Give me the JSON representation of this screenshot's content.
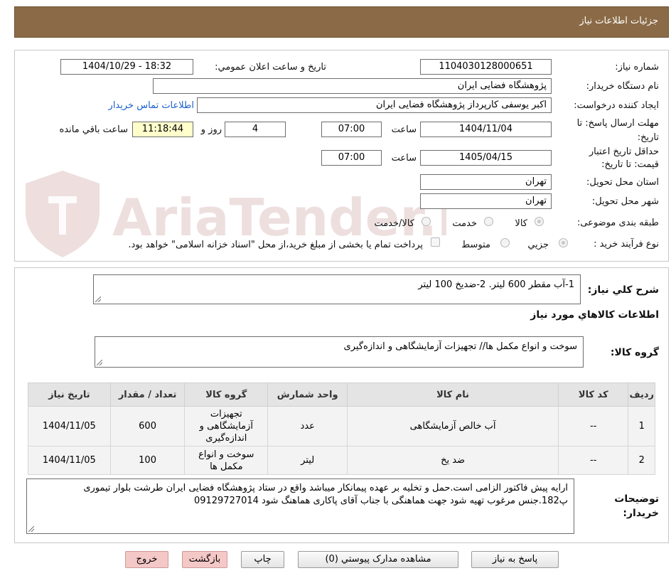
{
  "header": {
    "title": "جزئیات اطلاعات نیاز"
  },
  "form": {
    "need_number_label": "شماره نیاز:",
    "need_number": "1104030128000651",
    "announce_label": "تاریخ و ساعت اعلان عمومي:",
    "announce_value": "1404/10/29 - 18:32",
    "buyer_org_label": "نام دستگاه خریدار:",
    "buyer_org": "پژوهشگاه فضایی ایران",
    "requester_label": "ایجاد کننده درخواست:",
    "requester": "اکبر یوسفی کارپرداز پژوهشگاه فضایی ایران",
    "contact_link": "اطلاعات تماس خریدار",
    "deadline_label": "مهلت ارسال پاسخ: تا تاریخ:",
    "deadline_date": "1404/11/04",
    "time_label": "ساعت",
    "deadline_time": "07:00",
    "days_value": "4",
    "days_label": "روز و",
    "remaining_time": "11:18:44",
    "remaining_label": "ساعت باقي مانده",
    "validity_label": "حداقل تاریخ اعتبار قیمت: تا تاریخ:",
    "validity_date": "1405/04/15",
    "validity_time": "07:00",
    "province_label": "استان محل تحویل:",
    "province": "تهران",
    "city_label": "شهر محل تحویل:",
    "city": "تهران",
    "category_label": "طبقه بندی موضوعی:",
    "category_options": [
      "کالا",
      "خدمت",
      "کالا/خدمت"
    ],
    "process_label": "نوع فرآیند خرید :",
    "process_options": [
      "جزیي",
      "متوسط"
    ],
    "payment_note": "پرداخت تمام یا بخشی از مبلغ خرید،از محل \"اسناد خزانه اسلامی\" خواهد بود."
  },
  "summary": {
    "label": "شرح کلي نیاز:",
    "text": "1-آب مقطر 600 لیتر. 2-ضدیخ  100 لیتر"
  },
  "goods": {
    "section_title": "اطلاعات کالاهاي مورد نیاز",
    "group_label": "گروه کالا:",
    "group_text": "سوخت و انواع مکمل ها// تجهیزات آزمایشگاهی و اندازه‌گیری"
  },
  "table": {
    "headers": [
      "ردیف",
      "کد کالا",
      "نام کالا",
      "واحد شمارش",
      "گروه کالا",
      "تعداد / مقدار",
      "تاریخ نیاز"
    ],
    "rows": [
      [
        "1",
        "--",
        "آب خالص آزمایشگاهی",
        "عدد",
        "تجهیزات آزمایشگاهی و اندازه‌گیری",
        "600",
        "1404/11/05"
      ],
      [
        "2",
        "--",
        "ضد یخ",
        "لیتر",
        "سوخت و انواع مکمل ها",
        "100",
        "1404/11/05"
      ]
    ]
  },
  "notes": {
    "label": "توضیحات خریدار:",
    "text": "ارایه پیش فاکتور الزامی است.حمل و تخلیه بر عهده پیمانکار میباشد واقع در ستاد پژوهشگاه فضایی ایران طرشت بلوار تیموری پ182.جنس مرغوب تهیه شود جهت هماهنگی با جناب آقای پاکاری هماهنگ شود 09129727014"
  },
  "buttons": {
    "reply": "پاسخ به نیاز",
    "attachments": "مشاهده مدارک پیوستي (0)",
    "print": "چاپ",
    "back": "بازگشت",
    "exit": "خروج"
  },
  "watermark": {
    "text": "AriaTender.neT"
  },
  "colors": {
    "header_bg": "#8b6b47",
    "link": "#1a5fd0",
    "remaining_bg": "#ffffcc",
    "pink_button": "#f5c8c8"
  }
}
